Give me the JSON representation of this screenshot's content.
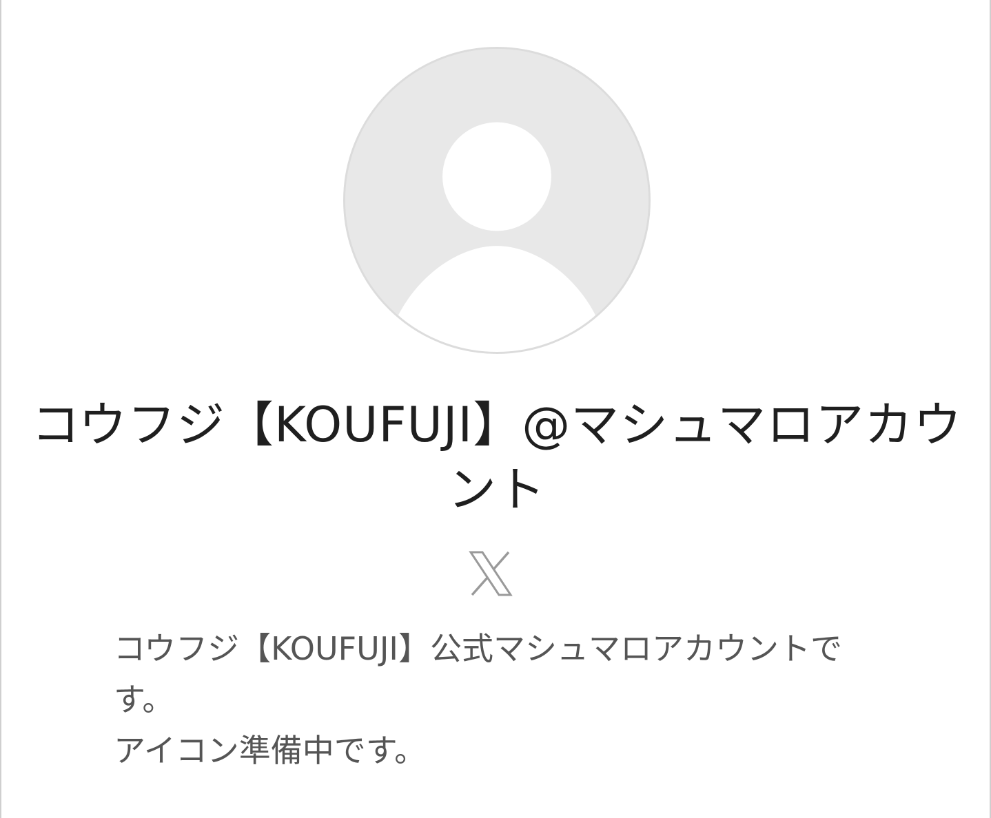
{
  "profile": {
    "display_name": "コウフジ【KOUFUJI】@マシュマロアカウント",
    "avatar": {
      "icon": "default-user-avatar-icon",
      "background_color": "#e8e8e8",
      "figure_color": "#ffffff"
    },
    "social_link": {
      "icon": "x-logo-icon"
    },
    "description_lines": [
      "コウフジ【KOUFUJI】公式マシュマロアカウントです。",
      "アイコン準備中です。"
    ]
  }
}
